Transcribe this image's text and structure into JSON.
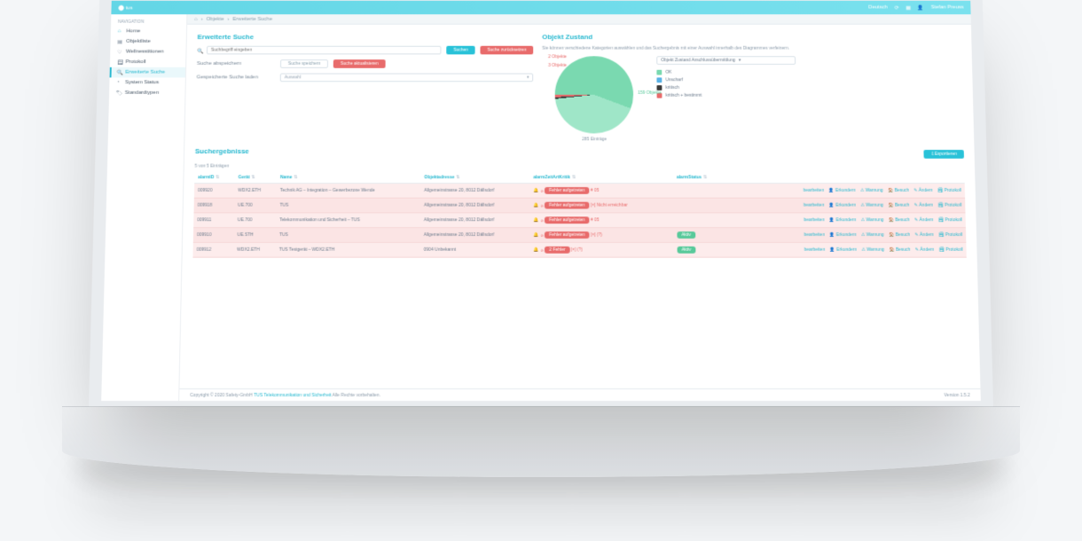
{
  "brand": "tus",
  "topbar": {
    "language": "Deutsch",
    "user": "Stefan Preuss"
  },
  "breadcrumb": [
    "Objekte",
    "Erweiterte Suche"
  ],
  "sidebar": {
    "section": "NAVIGATION",
    "items": [
      {
        "label": "Home",
        "icon": "home-icon"
      },
      {
        "label": "Objektliste",
        "icon": "list-icon"
      },
      {
        "label": "Wellnesstitionen",
        "icon": "heart-icon"
      },
      {
        "label": "Protokoll",
        "icon": "clipboard-icon"
      },
      {
        "label": "Erweiterte Suche",
        "icon": "search-icon",
        "active": true
      },
      {
        "label": "System Status",
        "icon": "gauge-icon"
      },
      {
        "label": "Standardtypen",
        "icon": "tag-icon"
      }
    ]
  },
  "search_panel": {
    "title": "Erweiterte Suche",
    "input_placeholder": "Suchbegriff eingeben",
    "btn_search": "Suchen",
    "btn_reset": "Suche zurücksetzen",
    "row_save_label": "Suche abspeichern",
    "btn_save": "Suche speichern",
    "btn_new": "Suche aktualisieren",
    "row_load_label": "Gespeicherte Suche laden",
    "select_placeholder": "Auswahl"
  },
  "state_panel": {
    "title": "Objekt Zustand",
    "desc": "Sie können verschiedene Kategorien auswählen und das Suchergebnis mit einer Auswahl innerhalb des Diagrammes verfeinern.",
    "select_label": "Objekt Zustand Anschlussübermittlung",
    "legend": [
      {
        "label": "OK",
        "color": "#7ad9b0"
      },
      {
        "label": "Unscharf",
        "color": "#5ab2e6"
      },
      {
        "label": "kritisch",
        "color": "#3a3a3a"
      },
      {
        "label": "kritisch + bestimmt",
        "color": "#e86b6b"
      }
    ],
    "pie_caption": "285 Einträge",
    "pie_labels": {
      "a": "2 Objekte",
      "b": "3 Objekte",
      "c": "159 Objekte"
    }
  },
  "chart_data": {
    "type": "pie",
    "title": "Objekt Zustand",
    "total_label": "285 Einträge",
    "series": [
      {
        "name": "OK",
        "value": 159,
        "color": "#7ad9b0"
      },
      {
        "name": "Unscharf",
        "value": 121,
        "color": "#9fe6c8"
      },
      {
        "name": "kritisch",
        "value": 2,
        "color": "#3a3a3a"
      },
      {
        "name": "kritisch + bestimmt",
        "value": 3,
        "color": "#e86b6b"
      }
    ]
  },
  "results": {
    "title": "Suchergebnisse",
    "sub": "5 von 5 Einträgen",
    "export_btn": "Exportieren",
    "columns": [
      "alarmID",
      "Gerät",
      "Name",
      "Objektadresse",
      "alarmZeitArtKritik",
      "alarmStatus",
      ""
    ],
    "rows": [
      {
        "alarmID": "009920",
        "device": "WDX2.ETH",
        "name": "Technik AG – Integration – Gewerbezone Wende",
        "address": "Allgemeinstrasse 20, 8012 Dällsdorf",
        "crit_icon": "alert",
        "crit_badge": "Fehler aufgetreten",
        "crit_extra": "# 05",
        "status": "",
        "status_ok": ""
      },
      {
        "alarmID": "009918",
        "device": "UE.700",
        "name": "TUS",
        "address": "Allgemeinstrasse 20, 8012 Dällsdorf",
        "crit_icon": "alert",
        "crit_badge": "Fehler aufgetreten",
        "crit_extra": "[×] Nicht erreichbar",
        "status": "",
        "status_ok": ""
      },
      {
        "alarmID": "009911",
        "device": "UE.700",
        "name": "Telekommunikation und Sicherheit – TUS",
        "address": "Allgemeinstrasse 20, 8012 Dällsdorf",
        "crit_icon": "alert",
        "crit_badge": "Fehler aufgetreten",
        "crit_extra": "# 05",
        "status": "",
        "status_ok": ""
      },
      {
        "alarmID": "009910",
        "device": "UE.STH",
        "name": "TUS",
        "address": "Allgemeinstrasse 20, 8012 Dällsdorf",
        "crit_icon": "alert",
        "crit_badge": "Fehler aufgetreten",
        "crit_extra": "[×] (?)",
        "status": "Aktiv",
        "status_ok": "green"
      },
      {
        "alarmID": "009912",
        "device": "WDX2.ETH",
        "name": "TUS Testgerät – WDX2.ETH",
        "address": "0904 Unbekannt",
        "crit_icon": "alert",
        "crit_badge": "2 Fehler",
        "crit_extra": "[×] (?)",
        "status": "Aktiv",
        "status_ok": "green"
      }
    ],
    "actions": {
      "a1": "bearbeiten",
      "a2": "Erkundern",
      "a3": "Warnung",
      "a4": "Besuch",
      "a5": "Ändern",
      "a6": "Protokoll"
    }
  },
  "footer": {
    "copyright": "Copyright © 2020 Safety-GmbH ",
    "link": "TUS Telekommunikation und Sicherheit",
    "rights": " Alle Rechte vorbehalten.",
    "version": "Version 1.5.2"
  }
}
